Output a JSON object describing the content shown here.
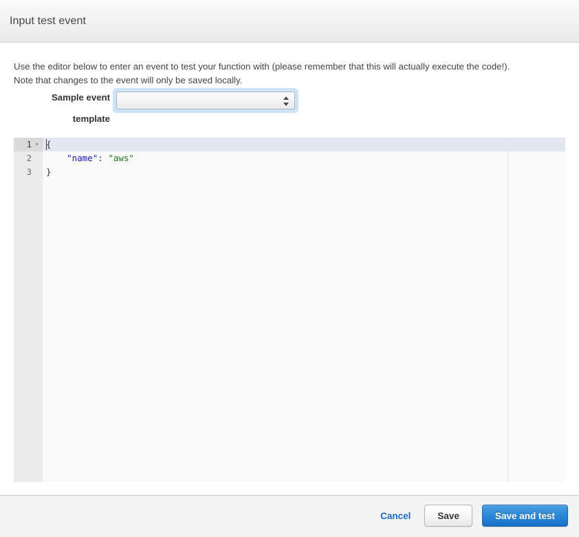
{
  "header": {
    "title": "Input test event"
  },
  "body": {
    "intro_line_1": "Use the editor below to enter an event to test your function with (please remember that this will actually execute the code!).",
    "intro_line_2": "Note that changes to the event will only be saved locally.",
    "sample_event_label": "Sample event",
    "template_label": "template",
    "sample_event_select": {
      "value": "",
      "placeholder": "",
      "options": []
    }
  },
  "editor": {
    "language": "json",
    "active_line": 1,
    "gutter": [
      {
        "number": "1",
        "active": true,
        "fold": "▾"
      },
      {
        "number": "2",
        "active": false,
        "fold": ""
      },
      {
        "number": "3",
        "active": false,
        "fold": ""
      }
    ],
    "lines": [
      {
        "indent": "",
        "parts": [
          {
            "text": "{",
            "type": "punc"
          }
        ]
      },
      {
        "indent": "    ",
        "parts": [
          {
            "text": "\"name\"",
            "type": "key"
          },
          {
            "text": ": ",
            "type": "punc"
          },
          {
            "text": "\"aws\"",
            "type": "str"
          }
        ]
      },
      {
        "indent": "",
        "parts": [
          {
            "text": "}",
            "type": "punc"
          }
        ]
      }
    ],
    "raw_text": "{\n    \"name\": \"aws\"\n}"
  },
  "footer": {
    "cancel_label": "Cancel",
    "save_label": "Save",
    "save_and_test_label": "Save and test"
  },
  "colors": {
    "primary_button": "#2f8ad8",
    "link": "#1a68c4",
    "json_key": "#1a1aa8",
    "json_string": "#1a7a1a",
    "active_line": "#e3e7f2",
    "footer_bg": "#f4f4f4"
  }
}
